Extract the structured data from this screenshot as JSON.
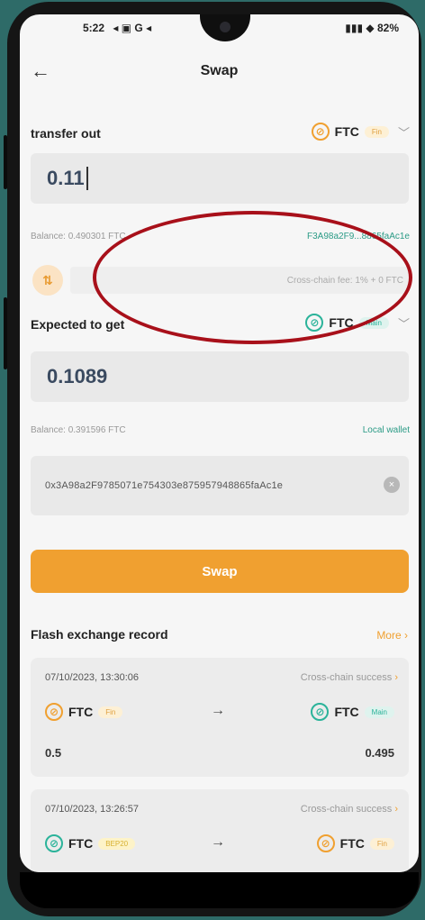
{
  "status_bar": {
    "time": "5:22",
    "left_icons": "◂ ▣ G ◂",
    "right_text": "82%"
  },
  "header": {
    "title": "Swap"
  },
  "transfer_out": {
    "label": "transfer out",
    "token": "FTC",
    "tag": "Fin",
    "amount": "0.11",
    "balance": "Balance: 0.490301 FTC",
    "address": "F3A98a2F9...8865faAc1e"
  },
  "fee": {
    "text": "Cross-chain fee: 1% + 0 FTC"
  },
  "expected": {
    "label": "Expected to get",
    "token": "FTC",
    "tag": "Main",
    "amount": "0.1089",
    "balance": "Balance: 0.391596 FTC",
    "wallet_link": "Local wallet"
  },
  "receive_address": {
    "value": "0x3A98a2F9785071e754303e875957948865faAc1e"
  },
  "swap_button": {
    "label": "Swap"
  },
  "records": {
    "title": "Flash exchange record",
    "more": "More",
    "items": [
      {
        "date": "07/10/2023, 13:30:06",
        "status": "Cross-chain success",
        "from_token": "FTC",
        "from_tag": "Fin",
        "to_token": "FTC",
        "to_tag": "Main",
        "from_amount": "0.5",
        "to_amount": "0.495"
      },
      {
        "date": "07/10/2023, 13:26:57",
        "status": "Cross-chain success",
        "from_token": "FTC",
        "from_tag": "BEP20",
        "to_token": "FTC",
        "to_tag": "Fin"
      }
    ]
  },
  "icons": {
    "back": "back-arrow-icon",
    "coin_fin": "ftc-fin-coin-icon",
    "coin_main": "ftc-main-coin-icon",
    "swap_direction": "swap-direction-icon",
    "clear": "clear-icon",
    "chevron": "chevron-down-icon"
  },
  "colors": {
    "accent": "#f0a030",
    "teal": "#2bb39a",
    "annotation": "#a8101a"
  }
}
